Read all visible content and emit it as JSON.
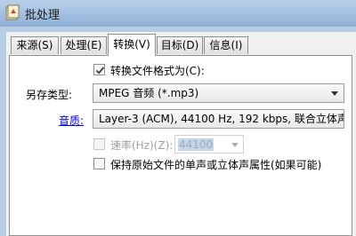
{
  "window": {
    "title": "批处理"
  },
  "tabs": [
    {
      "label": "来源(S)"
    },
    {
      "label": "处理(E)"
    },
    {
      "label": "转换(V)"
    },
    {
      "label": "目标(D)"
    },
    {
      "label": "信息(I)"
    }
  ],
  "active_tab": "转换(V)",
  "convert": {
    "convert_format_label": "转换文件格式为(C):",
    "convert_format_checked": true,
    "save_type_label": "另存类型:",
    "save_type_value": "MPEG 音频 (*.mp3)",
    "quality_label": "音质:",
    "quality_value": "Layer-3 (ACM), 44100 Hz, 192 kbps, 联合立体声",
    "rate_label": "速率(Hz)(Z):",
    "rate_checked": false,
    "rate_value": "44100",
    "keep_channels_label": "保持原始文件的单声或立体声属性(如果可能)",
    "keep_channels_checked": false
  }
}
